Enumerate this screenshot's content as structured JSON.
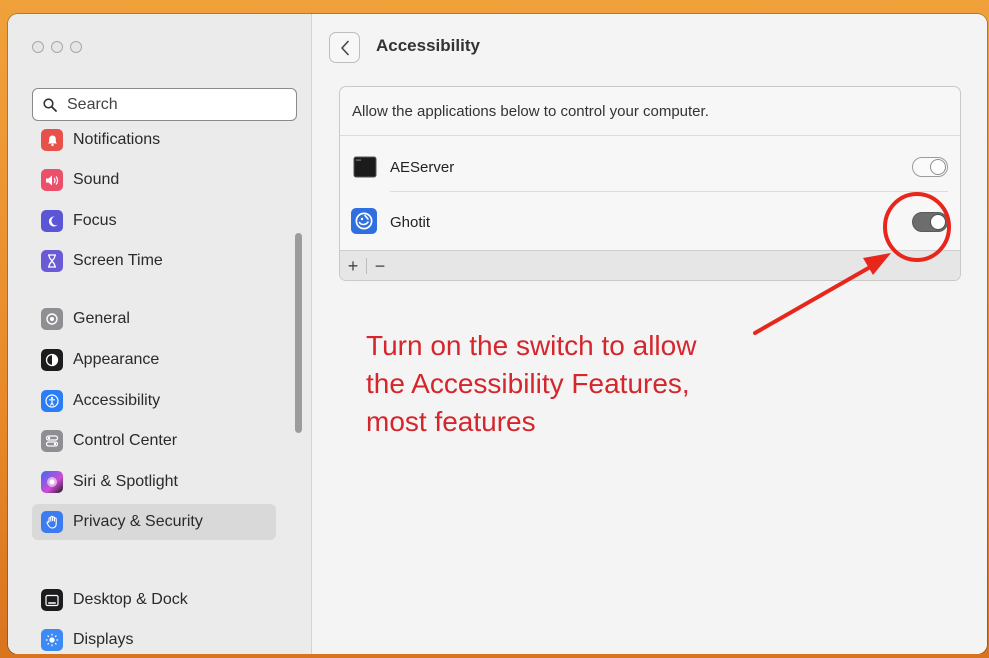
{
  "window": {
    "title": "Accessibility"
  },
  "search": {
    "placeholder": "Search"
  },
  "sidebar": {
    "items": [
      {
        "label": "Notifications",
        "icon": "bell-icon",
        "color": "#e8504a"
      },
      {
        "label": "Sound",
        "icon": "speaker-icon",
        "color": "#ec4f6a"
      },
      {
        "label": "Focus",
        "icon": "moon-icon",
        "color": "#5b56d6"
      },
      {
        "label": "Screen Time",
        "icon": "hourglass-icon",
        "color": "#6a5ad6"
      },
      {
        "label": "General",
        "icon": "gear-icon",
        "color": "#8e8e93"
      },
      {
        "label": "Appearance",
        "icon": "appearance-icon",
        "color": "#1c1c1e"
      },
      {
        "label": "Accessibility",
        "icon": "accessibility-icon",
        "color": "#2b7df5"
      },
      {
        "label": "Control Center",
        "icon": "control-center-icon",
        "color": "#8e8e93"
      },
      {
        "label": "Siri & Spotlight",
        "icon": "siri-icon",
        "color": "#8a5cf0"
      },
      {
        "label": "Privacy & Security",
        "icon": "hand-icon",
        "color": "#3d7cf0",
        "selected": true
      },
      {
        "label": "Desktop & Dock",
        "icon": "dock-icon",
        "color": "#1c1c1e"
      },
      {
        "label": "Displays",
        "icon": "sun-icon",
        "color": "#3d8af5"
      }
    ]
  },
  "main": {
    "back_label": "<",
    "title": "Accessibility",
    "panel": {
      "description": "Allow the applications below to control your computer.",
      "apps": [
        {
          "name": "AEServer",
          "icon": "terminal-icon",
          "enabled": false
        },
        {
          "name": "Ghotit",
          "icon": "ghotit-icon",
          "enabled": true
        }
      ],
      "add_label": "+",
      "remove_label": "−"
    }
  },
  "annotation": {
    "lines": [
      "Turn on the switch to allow",
      "the Accessibility Features,",
      "most features"
    ],
    "color": "#d4262c"
  }
}
